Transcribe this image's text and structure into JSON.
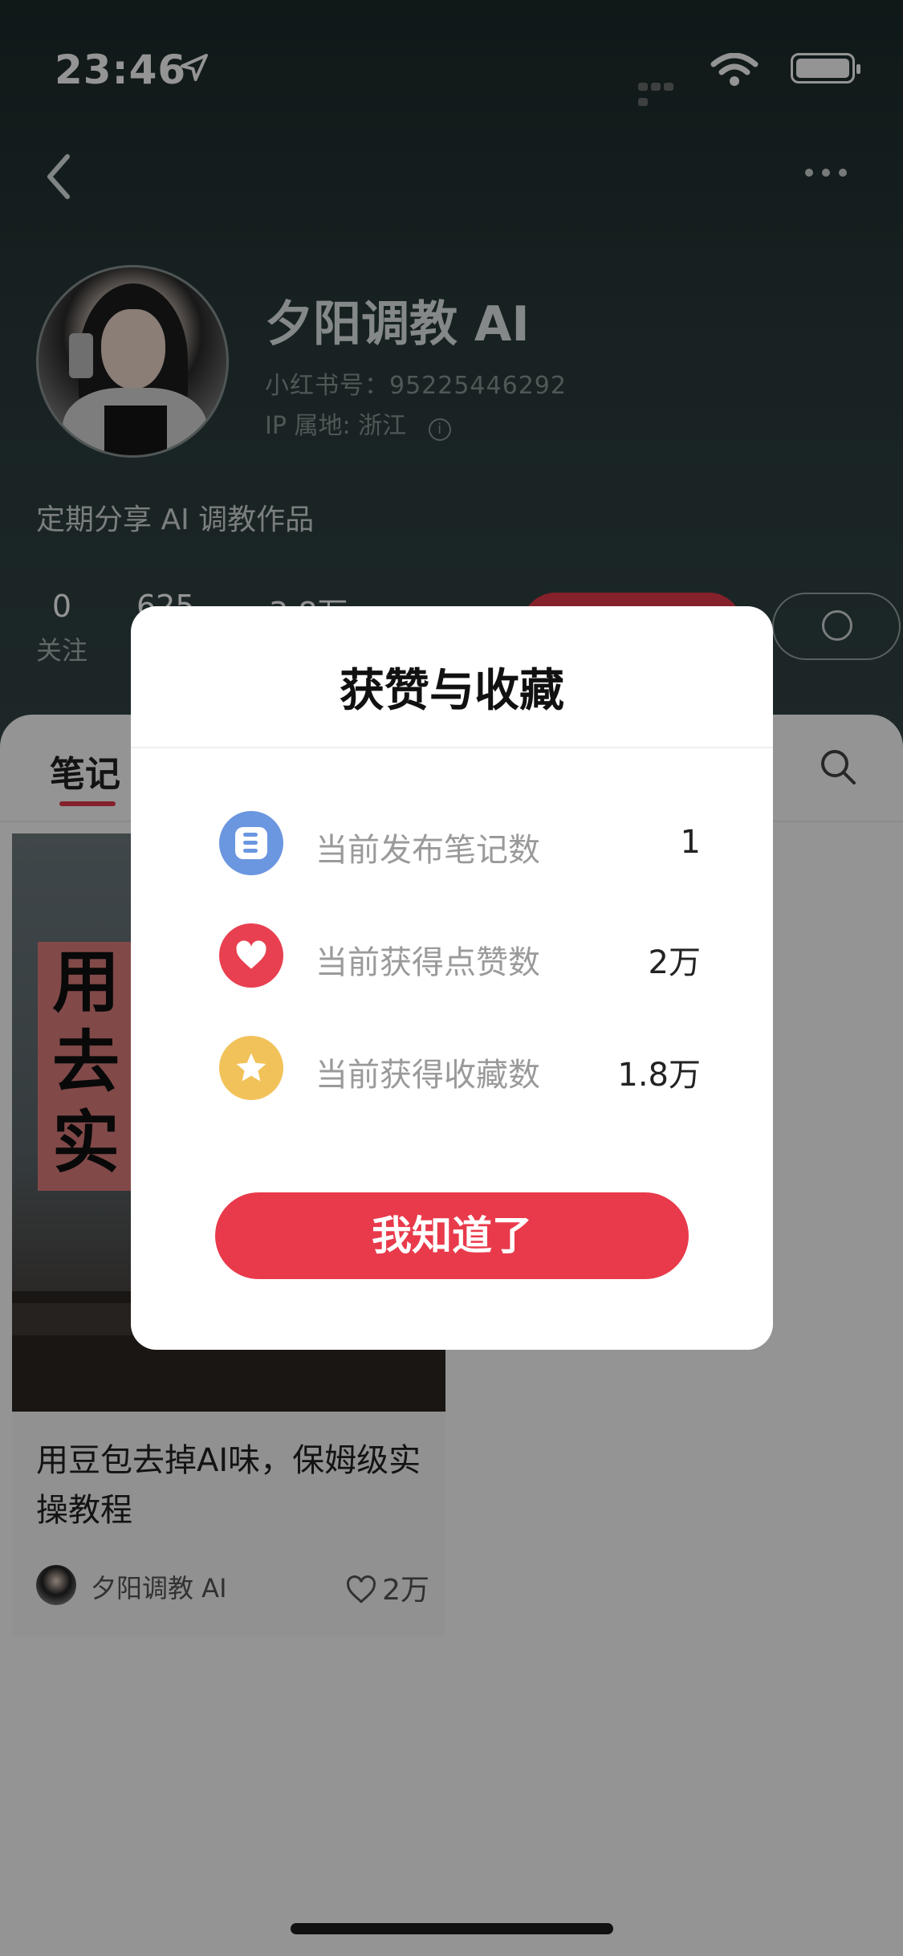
{
  "status_bar": {
    "time": "23:46"
  },
  "profile": {
    "nickname": "夕阳调教 AI",
    "red_id": "小红书号：95225446292",
    "ip_location": "IP 属地: 浙江",
    "bio": "定期分享 AI 调教作品"
  },
  "stats": [
    {
      "number": "0",
      "label": "关注"
    },
    {
      "number": "625",
      "label": ""
    },
    {
      "number": "3.8万",
      "label": ""
    }
  ],
  "tabs": {
    "notes": "笔记"
  },
  "note_card": {
    "image_text": [
      "用",
      "去",
      "实"
    ],
    "title": "用豆包去掉AI味，保姆级实操教程",
    "author": "夕阳调教 AI",
    "likes": "2万"
  },
  "modal": {
    "title": "获赞与收藏",
    "rows": [
      {
        "label": "当前发布笔记数",
        "value": "1",
        "icon": "note-icon",
        "color": "#6b96e0"
      },
      {
        "label": "当前获得点赞数",
        "value": "2万",
        "icon": "heart-icon",
        "color": "#e84050"
      },
      {
        "label": "当前获得收藏数",
        "value": "1.8万",
        "icon": "star-icon",
        "color": "#f2c25a"
      }
    ],
    "confirm_label": "我知道了"
  },
  "colors": {
    "accent": "#e83a4b",
    "header_bg": "#2a3b3b"
  }
}
